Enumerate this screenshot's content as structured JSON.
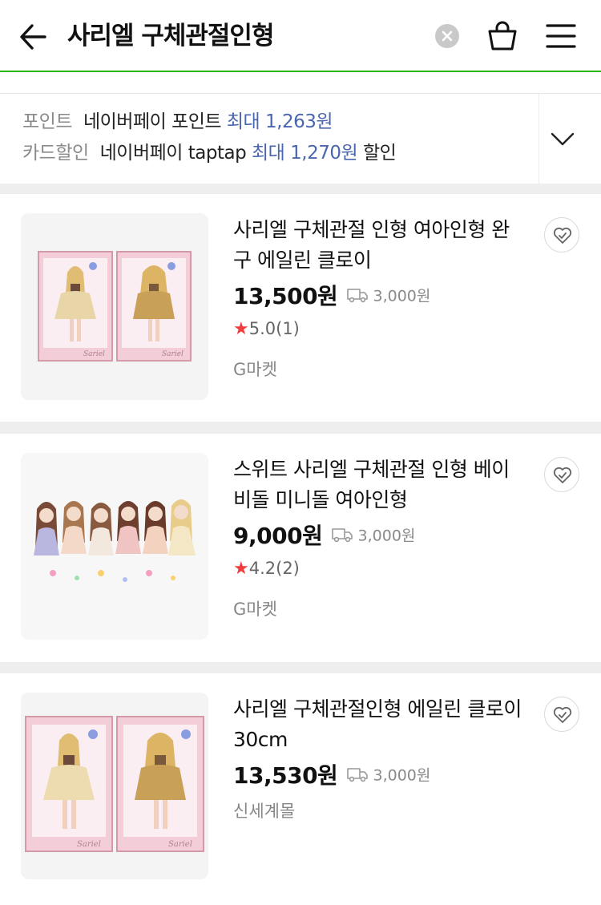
{
  "header": {
    "search_query": "사리엘 구체관절인형",
    "back_icon": "arrow-left-icon",
    "clear_icon": "clear-x-icon",
    "cart_icon": "shopping-bag-icon",
    "menu_icon": "hamburger-menu-icon"
  },
  "benefits": {
    "point": {
      "label": "포인트",
      "text": "네이버페이 포인트",
      "accent": "최대 1,263원",
      "suffix": ""
    },
    "card": {
      "label": "카드할인",
      "text": "네이버페이 taptap",
      "accent": "최대 1,270원",
      "suffix": "할인"
    }
  },
  "products": [
    {
      "title": "사리엘 구체관절 인형 여아인형 완구 에일린 클로이",
      "price": "13,500원",
      "shipping": "3,000원",
      "rating_star": "★",
      "rating": "5.0(1)",
      "mall": "G마켓"
    },
    {
      "title": "스위트 사리엘 구체관절 인형 베이비돌 미니돌 여아인형",
      "price": "9,000원",
      "shipping": "3,000원",
      "rating_star": "★",
      "rating": "4.2(2)",
      "mall": "G마켓"
    },
    {
      "title": "사리엘 구체관절인형 에일린 클로이 30cm",
      "price": "13,530원",
      "shipping": "3,000원",
      "mall": "신세계몰"
    }
  ],
  "box_brand": "Sariel",
  "colors": {
    "accent_green": "#2db400",
    "benefit_blue": "#4a66b0",
    "star_red": "#f23b3b"
  }
}
